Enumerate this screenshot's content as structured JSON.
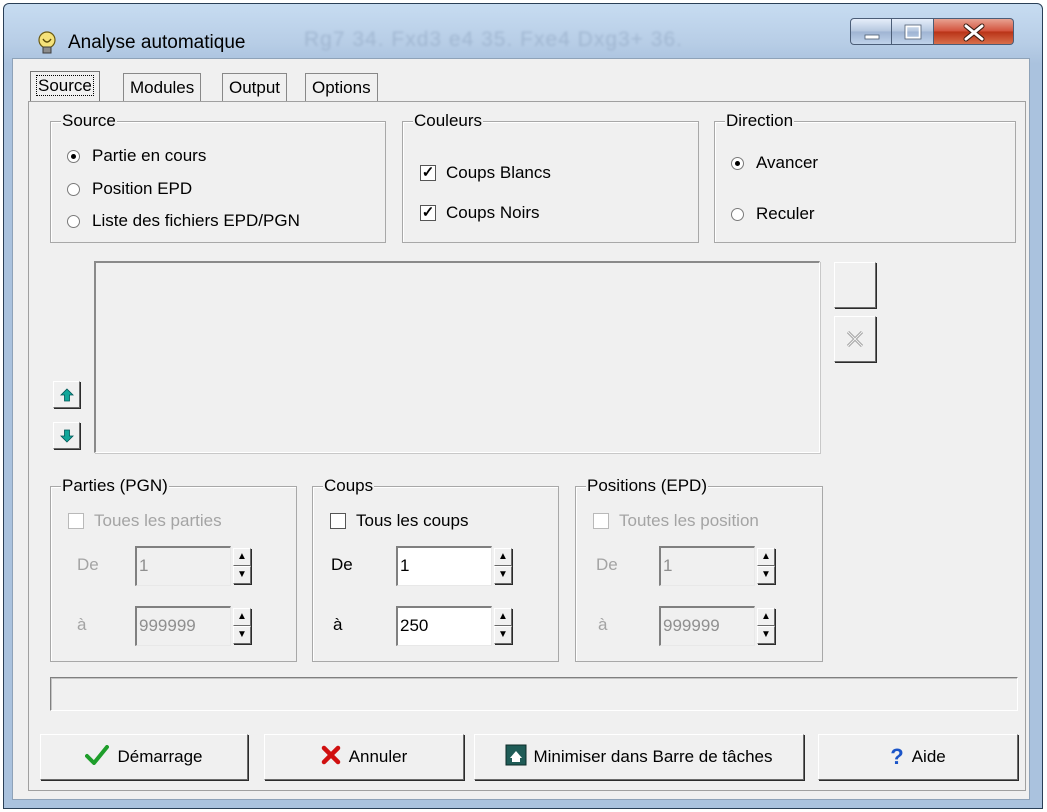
{
  "window": {
    "title": "Analyse automatique",
    "ghost_text": "Rg7 34. Fxd3 e4 35. Fxe4 Dxg3+ 36."
  },
  "tabs": [
    "Source",
    "Modules",
    "Output",
    "Options"
  ],
  "source_group": {
    "title": "Source",
    "options": [
      "Partie en cours",
      "Position EPD",
      "Liste des fichiers EPD/PGN"
    ],
    "selected": "Partie en cours"
  },
  "colors_group": {
    "title": "Couleurs",
    "white_label": "Coups Blancs",
    "white_checked": true,
    "black_label": "Coups Noirs",
    "black_checked": true
  },
  "direction_group": {
    "title": "Direction",
    "forward_label": "Avancer",
    "backward_label": "Reculer",
    "selected": "Avancer"
  },
  "games_group": {
    "title": "Parties (PGN)",
    "all_label": "Toues les parties",
    "from_label": "De",
    "from_value": "1",
    "to_label": "à",
    "to_value": "999999"
  },
  "moves_group": {
    "title": "Coups",
    "all_label": "Tous les coups",
    "from_label": "De",
    "from_value": "1",
    "to_label": "à",
    "to_value": "250"
  },
  "positions_group": {
    "title": "Positions (EPD)",
    "all_label": "Toutes les position",
    "from_label": "De",
    "from_value": "1",
    "to_label": "à",
    "to_value": "999999"
  },
  "buttons": {
    "start": "Démarrage",
    "cancel": "Annuler",
    "minimize": "Minimiser dans Barre de tâches",
    "help": "Aide"
  },
  "colors": {
    "check_green": "#1e9e2b",
    "cancel_red": "#d01010",
    "help_blue": "#1b55c8",
    "arrow_teal": "#11a79a"
  }
}
